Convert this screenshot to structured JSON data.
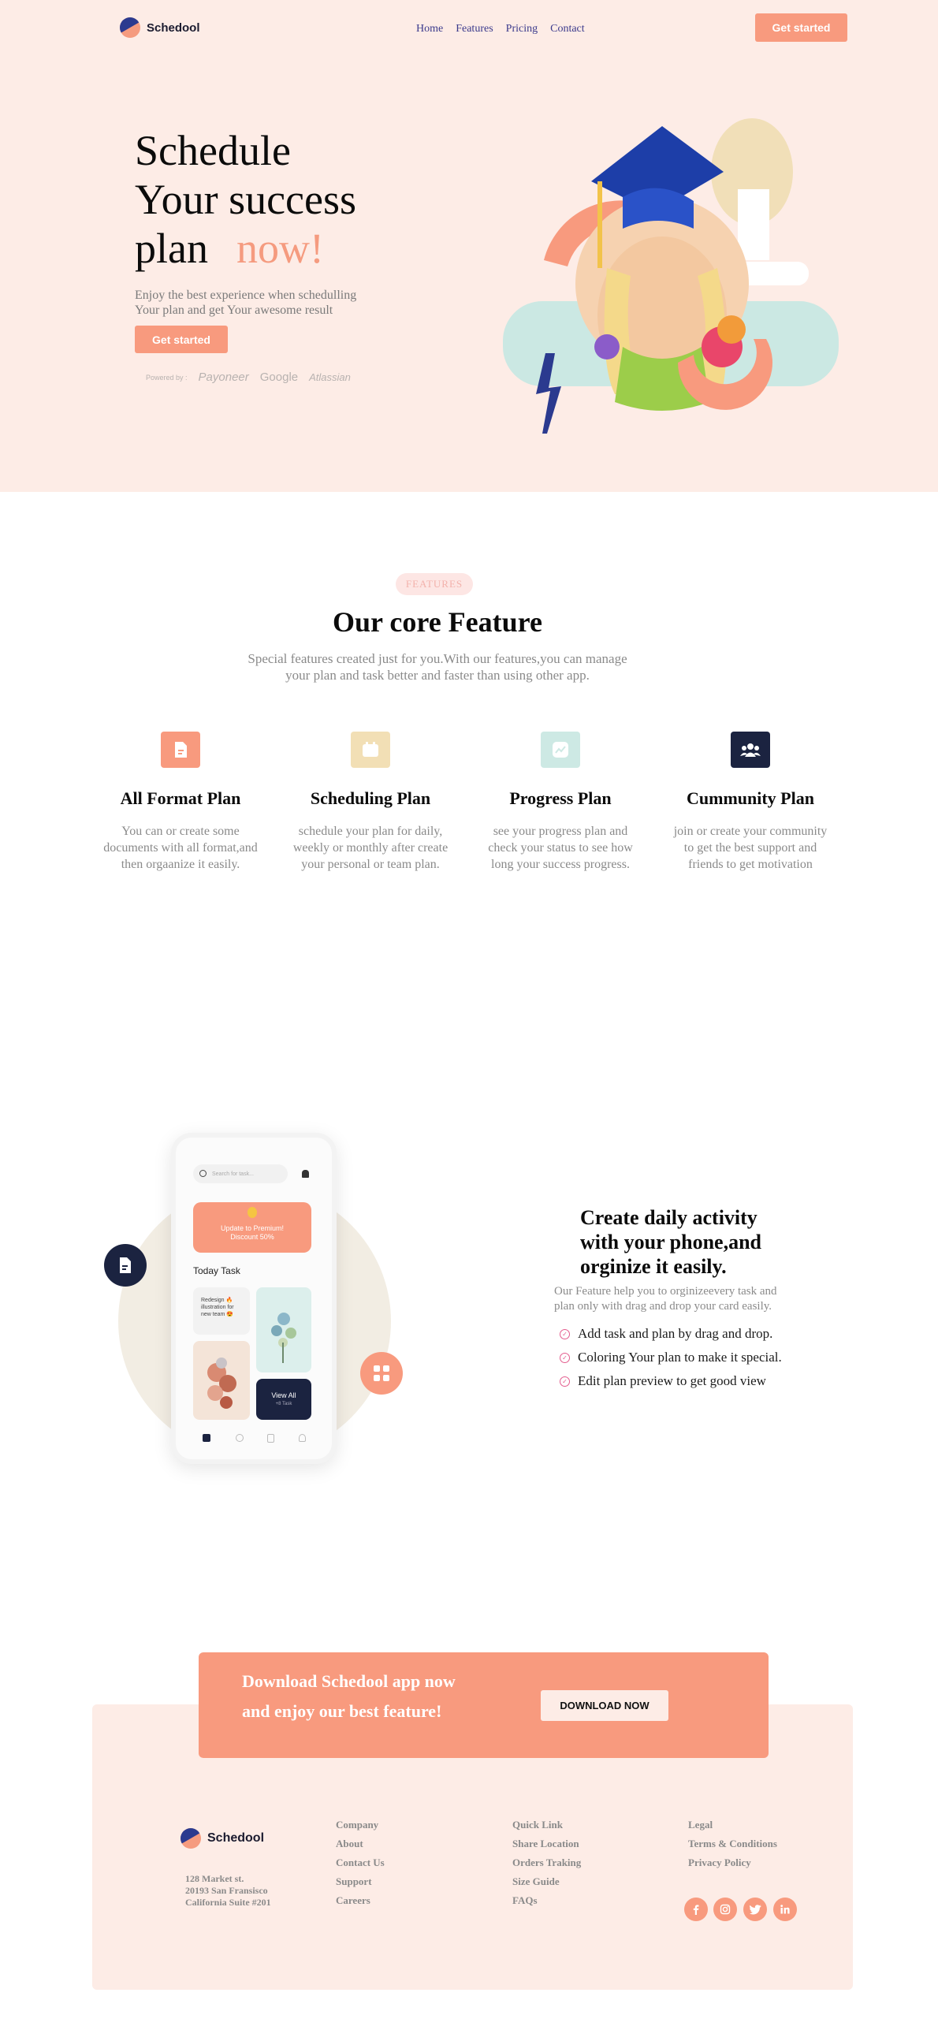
{
  "header": {
    "logo_text": "Schedool",
    "nav": [
      "Home",
      "Features",
      "Pricing",
      "Contact"
    ],
    "cta_label": "Get started"
  },
  "hero": {
    "title_line1": "Schedule",
    "title_line2": "Your success",
    "title_line3": "plan",
    "title_accent": "now!",
    "subtitle_line1": "Enjoy the best experience when schedulling",
    "subtitle_line2": "Your plan and get Your awesome result",
    "button_label": "Get started",
    "powered_by": "Powered by :",
    "brands": [
      "Payoneer",
      "Google",
      "Atlassian"
    ]
  },
  "features": {
    "pill": "FEATURES",
    "title": "Our core Feature",
    "lead_line1": "Special features created just for you.With our features,you can manage",
    "lead_line2": "your plan and task better and faster than using other app.",
    "items": [
      {
        "title": "All Format Plan",
        "line1": "You can or create some",
        "line2": "documents with all format,and",
        "line3": "then orgaanize it easily.",
        "icon": "document-icon",
        "color": "#f89a7e"
      },
      {
        "title": "Scheduling Plan",
        "line1": "schedule your plan for daily,",
        "line2": "weekly or monthly after create",
        "line3": "your personal or team plan.",
        "icon": "calendar-icon",
        "color": "#f2dfb5"
      },
      {
        "title": "Progress Plan",
        "line1": "see your progress plan and",
        "line2": "check your status to see how",
        "line3": "long your success progress.",
        "icon": "chart-icon",
        "color": "#cde9e4"
      },
      {
        "title": "Cummunity Plan",
        "line1": "join or create your community",
        "line2": "to get the best support and",
        "line3": "friends to get motivation",
        "icon": "community-icon",
        "color": "#1b2340"
      }
    ]
  },
  "activity": {
    "title_line1": "Create daily activity",
    "title_line2": "with your phone,and",
    "title_line3": "orginize it easily.",
    "sub_line1": "Our Feature help you to orginizeevery task and",
    "sub_line2": "plan only with drag and drop your card easily.",
    "checks": [
      "Add task and plan by drag and drop.",
      "Coloring Your plan to make it special.",
      "Edit plan preview to get good view"
    ],
    "phone": {
      "search_placeholder": "Search for task...",
      "promo_line1": "Update to Premium!",
      "promo_line2": "Discount 50%",
      "today_task": "Today Task",
      "card_text": "Redesign 🔥 illustration for new team 😍",
      "view_all": "View All",
      "view_all_sub": "+8 Task"
    }
  },
  "cta": {
    "line1": "Download Schedool app now",
    "line2": "and enjoy our best feature!",
    "button": "DOWNLOAD NOW"
  },
  "footer": {
    "logo_text": "Schedool",
    "address_line1": "128 Market st.",
    "address_line2": "20193 San Fransisco",
    "address_line3": "California Suite #201",
    "company": [
      "Company",
      "About",
      "Contact Us",
      "Support",
      "Careers"
    ],
    "quick": [
      "Quick Link",
      "Share Location",
      "Orders Traking",
      "Size Guide",
      "FAQs"
    ],
    "legal": [
      "Legal",
      "Terms & Conditions",
      "Privacy Policy"
    ],
    "socials": [
      "facebook-icon",
      "instagram-icon",
      "twitter-icon",
      "linkedin-icon"
    ]
  },
  "colors": {
    "peach": "#f89a7e",
    "hero_bg": "#fdece6",
    "navy": "#1b2340",
    "nav_link": "#3b3a8c"
  }
}
